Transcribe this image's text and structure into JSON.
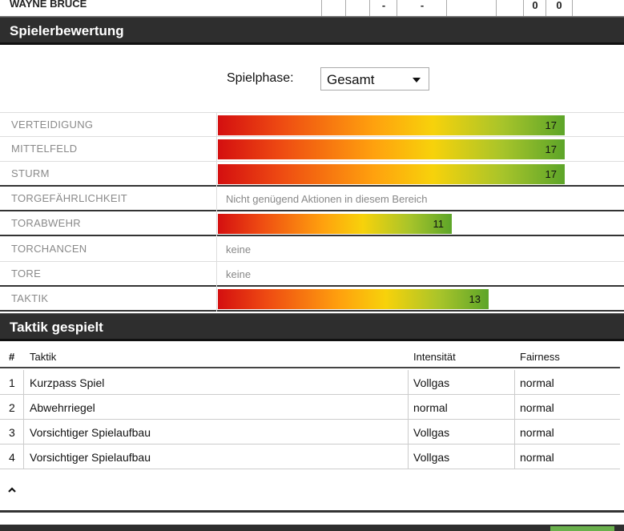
{
  "top_row": {
    "name": "WAYNE BRUCE",
    "cells": [
      "-",
      "-",
      "0",
      "0"
    ]
  },
  "rating_section": {
    "title": "Spielerbewertung",
    "phase_label": "Spielphase:",
    "phase_value": "Gesamt",
    "rows": [
      {
        "label": "VERTEIDIGUNG",
        "value": "17",
        "fill": 1.0
      },
      {
        "label": "MITTELFELD",
        "value": "17",
        "fill": 1.0
      },
      {
        "label": "STURM",
        "value": "17",
        "fill": 1.0
      },
      {
        "label": "TORGEFÄHRLICHKEIT",
        "note": "Nicht genügend Aktionen in diesem Bereich"
      },
      {
        "label": "TORABWEHR",
        "value": "11",
        "fill": 0.674
      },
      {
        "label": "TORCHANCEN",
        "note": "keine"
      },
      {
        "label": "TORE",
        "note": "keine"
      },
      {
        "label": "TAKTIK",
        "value": "13",
        "fill": 0.781
      }
    ]
  },
  "tactics_section": {
    "title": "Taktik gespielt",
    "headers": {
      "num": "#",
      "name": "Taktik",
      "intensity": "Intensität",
      "fairness": "Fairness"
    },
    "rows": [
      {
        "num": "1",
        "name": "Kurzpass Spiel",
        "intensity": "Vollgas",
        "fairness": "normal"
      },
      {
        "num": "2",
        "name": "Abwehrriegel",
        "intensity": "normal",
        "fairness": "normal"
      },
      {
        "num": "3",
        "name": "Vorsichtiger Spielaufbau",
        "intensity": "Vollgas",
        "fairness": "normal"
      },
      {
        "num": "4",
        "name": "Vorsichtiger Spielaufbau",
        "intensity": "Vollgas",
        "fairness": "normal"
      }
    ]
  },
  "collapse_icon": "caret-up-icon"
}
